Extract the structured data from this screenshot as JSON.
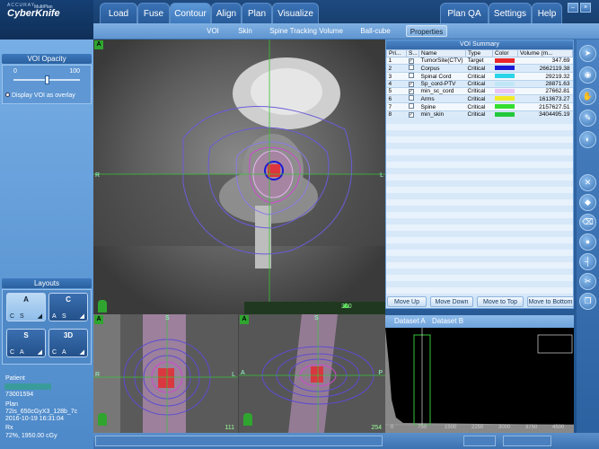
{
  "app": {
    "logo_small": "ACCURAY",
    "logo_big": "CyberKnife",
    "logo_sub": "MultiPlan"
  },
  "tabs": [
    {
      "label": "Load"
    },
    {
      "label": "Fuse"
    },
    {
      "label": "Contour"
    },
    {
      "label": "Align"
    },
    {
      "label": "Plan"
    },
    {
      "label": "Visualize"
    }
  ],
  "right_tabs": [
    {
      "label": "Plan QA"
    },
    {
      "label": "Settings"
    },
    {
      "label": "Help"
    }
  ],
  "subtabs": [
    {
      "label": "VOI"
    },
    {
      "label": "Skin"
    },
    {
      "label": "Spine Tracking Volume"
    },
    {
      "label": "Ball-cube"
    },
    {
      "label": "Properties"
    }
  ],
  "voi_opacity": {
    "title": "VOI Opacity",
    "min": "0",
    "max": "100",
    "value": 0.5,
    "overlay_label": "Display VOI as overlay"
  },
  "layouts": {
    "title": "Layouts",
    "options": [
      {
        "main": "A",
        "a": "C",
        "b": "S"
      },
      {
        "main": "C",
        "a": "A",
        "b": "S"
      },
      {
        "main": "S",
        "a": "C",
        "b": "A"
      },
      {
        "main": "3D",
        "a": "C",
        "b": "A"
      }
    ]
  },
  "patient": {
    "label": "Patient",
    "id": "73001594",
    "plan_label": "Plan",
    "plan_name": "72is_650cGyX3_128b_7c",
    "plan_date": "2016-10-19 16:31:04",
    "rx_label": "Rx",
    "rx_value": "72%, 1950.00 cGy"
  },
  "views": {
    "main_badge": "A",
    "sag_badge": "A",
    "cor_badge": "A",
    "main_slider": "300",
    "main_left": "R",
    "main_right": "L",
    "sag_left": "R",
    "sag_right": "L",
    "sag_top": "S",
    "cor_left": "A",
    "cor_right": "P",
    "cor_top": "S",
    "sag_num": "111",
    "cor_num": "254"
  },
  "voi_summary": {
    "title": "VOI Summary",
    "headers": [
      "Pri...",
      "S...",
      "Name",
      "Type",
      "Color",
      "Volume (m..."
    ],
    "rows": [
      {
        "pri": "1",
        "checked": true,
        "name": "TumorSite(CTV)",
        "type": "Target",
        "color": "#e8262b",
        "volume": "347.69"
      },
      {
        "pri": "2",
        "checked": false,
        "name": "Corpus",
        "type": "Critical",
        "color": "#1a1ad6",
        "volume": "2662119.38"
      },
      {
        "pri": "3",
        "checked": false,
        "name": "Spinal Cord",
        "type": "Critical",
        "color": "#2ad4e8",
        "volume": "29219.32"
      },
      {
        "pri": "4",
        "checked": true,
        "name": "Sp_cord-PTV",
        "type": "Critical",
        "color": "#bfe7f7",
        "volume": "28871.63"
      },
      {
        "pri": "5",
        "checked": true,
        "name": "min_sc_cord",
        "type": "Critical",
        "color": "#e9c6f5",
        "volume": "27662.81"
      },
      {
        "pri": "6",
        "checked": false,
        "name": "Arms",
        "type": "Critical",
        "color": "#f2ea2a",
        "volume": "1613673.27"
      },
      {
        "pri": "7",
        "checked": false,
        "name": "Spine",
        "type": "Critical",
        "color": "#34dd2e",
        "volume": "2157627.51"
      },
      {
        "pri": "8",
        "checked": true,
        "name": "min_skin",
        "type": "Critical",
        "color": "#22c93c",
        "volume": "3404495.19"
      },
      {
        "pri": "9",
        "checked": false,
        "name": "Skin",
        "type": "Critical",
        "color": "#0e7a24",
        "volume": "64056276.99"
      }
    ],
    "buttons": [
      "Move Up",
      "Move Down",
      "Move to Top",
      "Move to Bottom"
    ]
  },
  "dataset": {
    "tab_a": "Dataset A",
    "tab_b": "Dataset B",
    "ticks": [
      "0",
      "750",
      "1500",
      "2250",
      "3000",
      "3750",
      "4500"
    ]
  },
  "toolbar_icons": [
    "arrow-cursor-icon",
    "select-cursor-icon",
    "hand-pan-icon",
    "pencil-draw-icon",
    "window-level-icon",
    "close-contour-icon",
    "fill-contour-icon",
    "erase-contour-icon",
    "brush-icon",
    "ruler-icon",
    "cut-icon",
    "copy-contour-icon"
  ]
}
